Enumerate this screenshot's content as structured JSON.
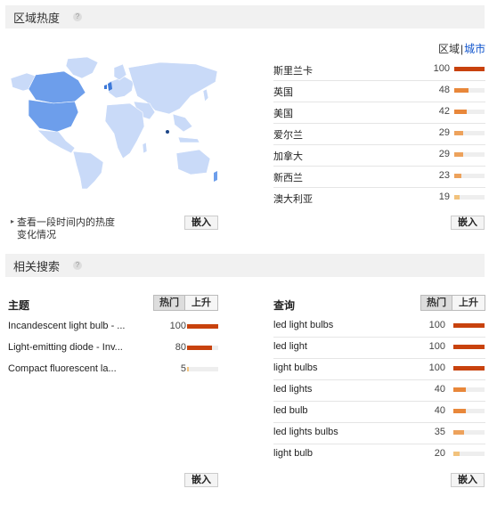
{
  "region": {
    "title": "区域热度",
    "toggle_region": "区域",
    "toggle_sep": "|",
    "toggle_city": "城市",
    "rows": [
      {
        "label": "斯里兰卡",
        "value": 100,
        "color": "#c8420d"
      },
      {
        "label": "英国",
        "value": 48,
        "color": "#e8873a"
      },
      {
        "label": "美国",
        "value": 42,
        "color": "#e8873a"
      },
      {
        "label": "爱尔兰",
        "value": 29,
        "color": "#eda25c"
      },
      {
        "label": "加拿大",
        "value": 29,
        "color": "#eda25c"
      },
      {
        "label": "新西兰",
        "value": 23,
        "color": "#eda25c"
      },
      {
        "label": "澳大利亚",
        "value": 19,
        "color": "#f2c27c"
      }
    ],
    "link_line1": "查看一段时间内的热度",
    "link_line2": "变化情况",
    "embed_left": "嵌入",
    "embed_right": "嵌入"
  },
  "related": {
    "title": "相关搜索",
    "topics": {
      "header": "主题",
      "tab_hot": "热门",
      "tab_rising": "上升",
      "rows": [
        {
          "label": "Incandescent light bulb - ...",
          "value": 100,
          "color": "#c8420d"
        },
        {
          "label": "Light-emitting diode - Inv...",
          "value": 80,
          "color": "#c8420d"
        },
        {
          "label": "Compact fluorescent la...",
          "value": 5,
          "color": "#f2c27c"
        }
      ],
      "embed": "嵌入"
    },
    "queries": {
      "header": "查询",
      "tab_hot": "热门",
      "tab_rising": "上升",
      "rows": [
        {
          "label": "led light bulbs",
          "value": 100,
          "color": "#c8420d"
        },
        {
          "label": "led light",
          "value": 100,
          "color": "#c8420d"
        },
        {
          "label": "light bulbs",
          "value": 100,
          "color": "#c8420d"
        },
        {
          "label": "led lights",
          "value": 40,
          "color": "#e8873a"
        },
        {
          "label": "led bulb",
          "value": 40,
          "color": "#e8873a"
        },
        {
          "label": "led lights bulbs",
          "value": 35,
          "color": "#eda25c"
        },
        {
          "label": "light bulb",
          "value": 20,
          "color": "#f2c27c"
        }
      ],
      "embed": "嵌入"
    }
  }
}
